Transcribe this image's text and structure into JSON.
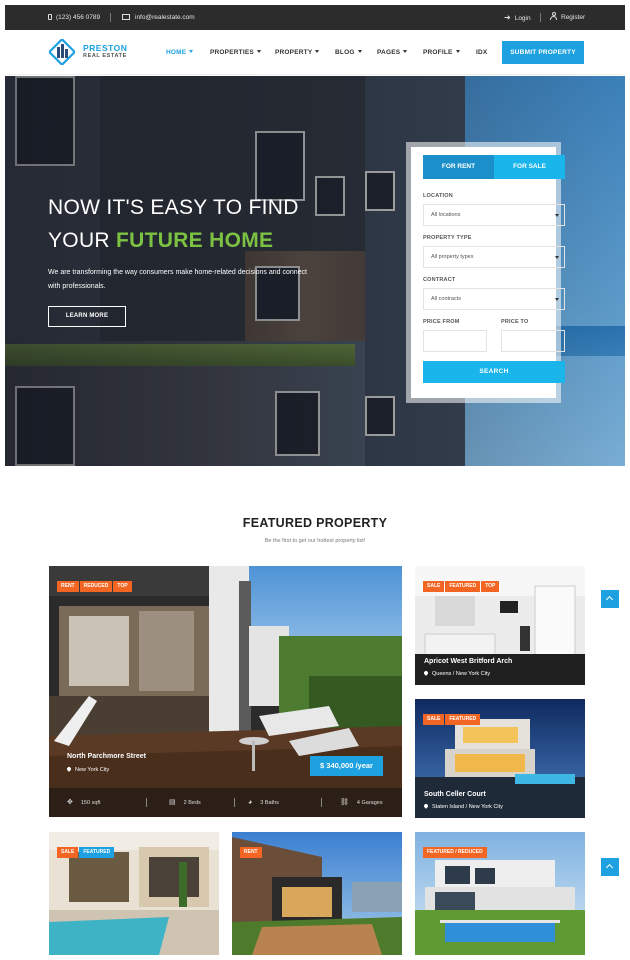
{
  "topbar": {
    "phone": "(123) 456 0789",
    "email": "info@realestate.com",
    "login": "Login",
    "register": "Register"
  },
  "brand": {
    "name": "PRESTON",
    "sub": "REAL ESTATE"
  },
  "nav": {
    "items": [
      {
        "label": "HOME",
        "active": true
      },
      {
        "label": "PROPERTIES"
      },
      {
        "label": "PROPERTY"
      },
      {
        "label": "BLOG"
      },
      {
        "label": "PAGES"
      },
      {
        "label": "PROFILE"
      },
      {
        "label": "IDX"
      }
    ],
    "submit": "SUBMIT PROPERTY"
  },
  "hero": {
    "title_line1": "NOW IT'S EASY TO FIND",
    "title_line2_a": "YOUR ",
    "title_line2_b": "FUTURE HOME",
    "description": "We are transforming the way consumers make home-related decisions and connect with professionals.",
    "button": "LEARN MORE"
  },
  "search": {
    "tab_rent": "FOR RENT",
    "tab_sale": "FOR SALE",
    "location_label": "LOCATION",
    "location_value": "All locations",
    "type_label": "PROPERTY TYPE",
    "type_value": "All property types",
    "contract_label": "CONTRACT",
    "contract_value": "All contracts",
    "price_from": "PRICE FROM",
    "price_to": "PRICE TO",
    "button": "SEARCH"
  },
  "featured": {
    "title": "FEATURED PROPERTY",
    "subtitle": "Be the first to get our hottest property list!",
    "main": {
      "badges": [
        "RENT",
        "REDUCED",
        "TOP"
      ],
      "name": "North Parchmore Street",
      "location": "New York City",
      "price": "$ 340,000 /year",
      "area": "150 sqft",
      "beds": "2 Beds",
      "baths": "3 Baths",
      "garages": "4 Garages"
    },
    "side1": {
      "badges": [
        "SALE",
        "FEATURED",
        "TOP"
      ],
      "name": "Apricot West Britford Arch",
      "location": "Queens / New York City"
    },
    "side2": {
      "badges": [
        "SALE",
        "FEATURED"
      ],
      "name": "South Celler Court",
      "location": "Staten Island / New York City"
    },
    "bottom1": {
      "badges": [
        "SALE",
        "FEATURED"
      ]
    },
    "bottom2": {
      "badges": [
        "RENT"
      ]
    },
    "bottom3": {
      "badges": [
        "FEATURED / REDUCED"
      ]
    }
  },
  "colors": {
    "accent": "#1da1e0",
    "green": "#7cc242",
    "orange": "#f26522",
    "topbar": "#2c2c2c"
  }
}
